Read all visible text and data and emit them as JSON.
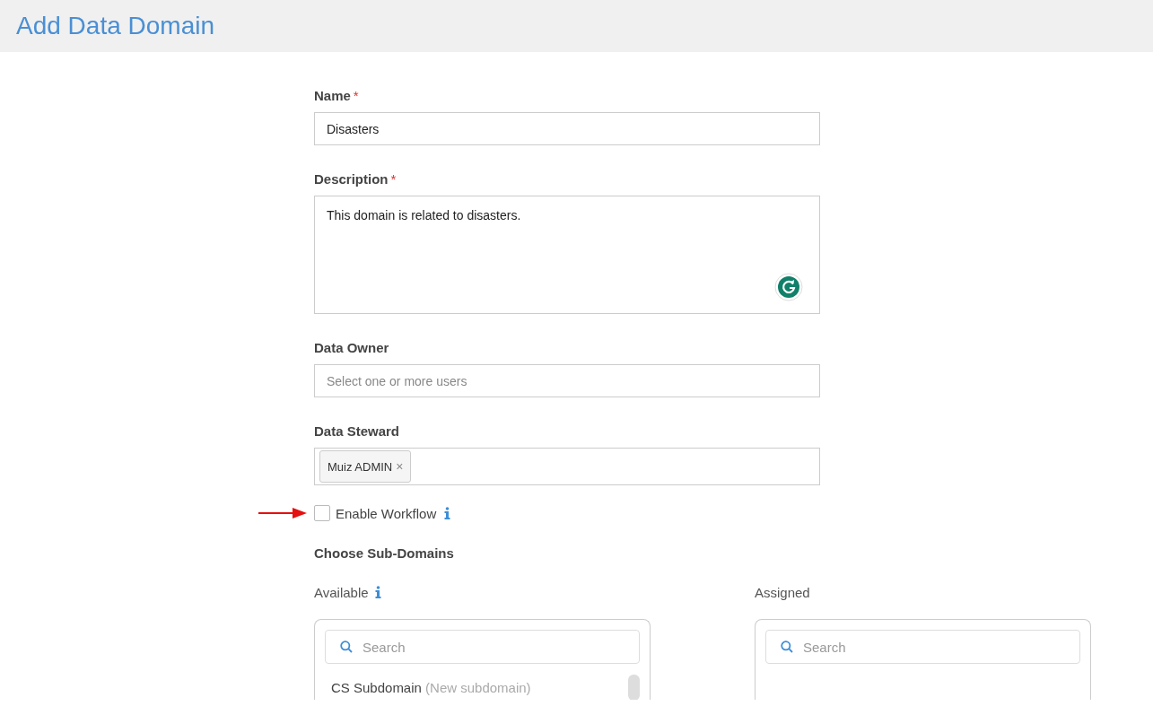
{
  "header": {
    "title": "Add Data Domain"
  },
  "form": {
    "required_mark": "*",
    "fields": [
      {
        "kind": "text",
        "label": "Name",
        "required": true,
        "value": "Disasters"
      },
      {
        "kind": "textarea",
        "label": "Description",
        "required": true,
        "value": "This domain is related to disasters."
      },
      {
        "kind": "select",
        "label": "Data Owner",
        "required": false,
        "placeholder": "Select one or more users"
      },
      {
        "kind": "tags",
        "label": "Data Steward",
        "required": false,
        "tags": [
          {
            "label": "Muiz ADMIN",
            "remove": "×"
          }
        ]
      }
    ]
  },
  "workflow": {
    "label": "Enable Workflow",
    "checked": false
  },
  "subdomains": {
    "title": "Choose Sub-Domains",
    "panels": [
      {
        "label": "Available",
        "info": true,
        "search_placeholder": "Search",
        "items": [
          {
            "name": "CS Subdomain",
            "note": "(New subdomain)"
          }
        ]
      },
      {
        "label": "Assigned",
        "info": false,
        "search_placeholder": "Search"
      }
    ]
  }
}
